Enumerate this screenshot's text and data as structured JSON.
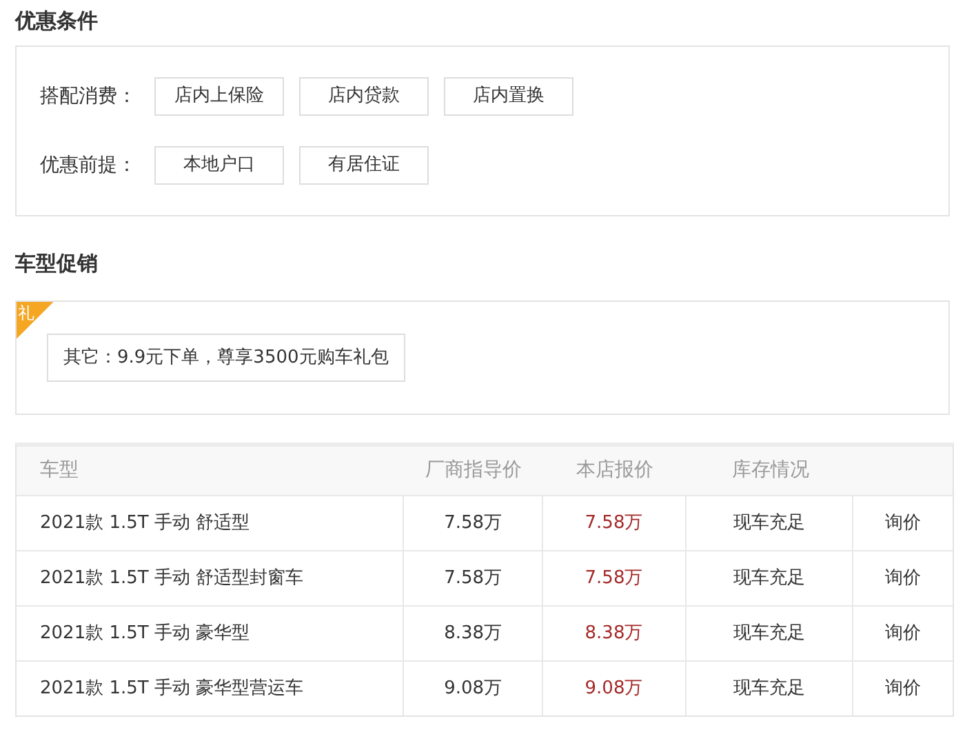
{
  "conditions": {
    "title": "优惠条件",
    "groups": [
      {
        "label": "搭配消费：",
        "options": [
          "店内上保险",
          "店内贷款",
          "店内置换"
        ]
      },
      {
        "label": "优惠前提：",
        "options": [
          "本地户口",
          "有居住证"
        ]
      }
    ]
  },
  "promotion": {
    "title": "车型促销",
    "badge": "礼",
    "offer": "其它：9.9元下单，尊享3500元购车礼包"
  },
  "table": {
    "columns": [
      "车型",
      "厂商指导价",
      "本店报价",
      "库存情况"
    ],
    "rows": [
      {
        "model": "2021款 1.5T 手动 舒适型",
        "msrp": "7.58万",
        "price": "7.58万",
        "stock": "现车充足",
        "action": "询价"
      },
      {
        "model": "2021款 1.5T 手动 舒适型封窗车",
        "msrp": "7.58万",
        "price": "7.58万",
        "stock": "现车充足",
        "action": "询价"
      },
      {
        "model": "2021款 1.5T 手动 豪华型",
        "msrp": "8.38万",
        "price": "8.38万",
        "stock": "现车充足",
        "action": "询价"
      },
      {
        "model": "2021款 1.5T 手动 豪华型营运车",
        "msrp": "9.08万",
        "price": "9.08万",
        "stock": "现车充足",
        "action": "询价"
      }
    ]
  }
}
